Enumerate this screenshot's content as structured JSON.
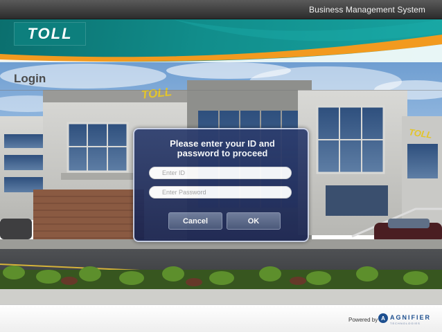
{
  "header": {
    "app_title": "Business Management System",
    "logo_text": "TOLL"
  },
  "page": {
    "heading": "Login"
  },
  "dialog": {
    "prompt_line1": "Please enter your ID and",
    "prompt_line2": "password to proceed",
    "id_field": {
      "value": "",
      "placeholder": "Enter ID"
    },
    "password_field": {
      "value": "",
      "placeholder": "Enter Password"
    },
    "cancel_label": "Cancel",
    "ok_label": "OK"
  },
  "footer": {
    "powered_by": "Powered by",
    "vendor_name": "AGNIFIER",
    "vendor_tagline": "TECHNOLOGIES",
    "vendor_icon": "agnifier-logo-icon"
  },
  "colors": {
    "brand_teal": "#118d8b",
    "brand_orange": "#f29a1f",
    "dialog_blue": "#1f2b5c",
    "topbar": "#3b3b3b"
  }
}
